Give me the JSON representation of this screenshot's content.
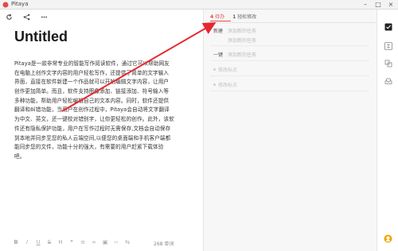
{
  "window": {
    "title": "Pitaya"
  },
  "editor": {
    "title": "Untitled",
    "body_lines": [
      "Pitaya是一款非常专业的智能写作阅读软件，通过它可以帮助网友",
      "在电脑上创作文字内容的用户轻松写作，还提供了简单的文字输入",
      "界面，直接在软件新建一个作品就可以开始编辑文字内容，让用户",
      "创作更加简单。而且，软件支持图像添加、链接添加、符号输入等",
      "多种功能，帮助用户轻松编辑自己的文本内容。同时，软件还提供",
      "翻译和纠错功能，当用户在创作过程中，Pitaya会自动将文字翻译",
      "为中文、英文，还一键校对错别字，让你更轻松的创作。此外，该软",
      "件还有隐私保护功能，用户在写作过程时无需保存,文档会自动保存",
      "到本地并同步至您的私人云端空间,以便您的桌面端和手机客户端都",
      "能同步您的文件，功能十分的强大，有需要的用户赶紧下载体验",
      "吧。"
    ],
    "word_count": "268 单词"
  },
  "panel": {
    "tabs": [
      {
        "num": "4",
        "label": "待办"
      },
      {
        "num": "1",
        "label": "轻松修改"
      }
    ],
    "rows": [
      {
        "title": "新建",
        "placeholder": "添加新的任务"
      },
      {
        "title": "",
        "placeholder": "添加新的任务"
      },
      {
        "title": "一键",
        "placeholder": "添加新的任务"
      },
      {
        "title": "",
        "placeholder": "修改标点"
      },
      {
        "title": "",
        "placeholder": "修改标点"
      }
    ]
  },
  "colors": {
    "accent": "#e34b4b",
    "check_icon": "#222222",
    "badge": "#f0a500"
  },
  "icons": {
    "toolbar_top": [
      "refresh-icon",
      "share-icon",
      "more-icon"
    ],
    "toolbar_bottom": [
      "bold-icon",
      "italic-icon",
      "underline-icon",
      "strikethrough-icon",
      "heading-icon",
      "quote-icon",
      "list-icon",
      "link-icon",
      "image-icon",
      "code-icon",
      "translate-icon"
    ],
    "rail": [
      "checklist-icon",
      "translate-icon",
      "correct-icon",
      "inbox-icon",
      "badge-icon"
    ]
  }
}
